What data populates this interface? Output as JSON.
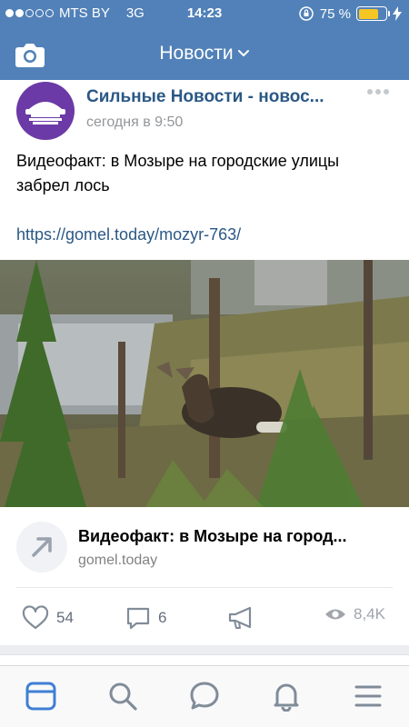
{
  "status_bar": {
    "carrier": "MTS BY",
    "network": "3G",
    "time": "14:23",
    "battery_percent": "75 %",
    "battery_level": 0.75,
    "signal_bars_filled": 2,
    "signal_bars_total": 5
  },
  "header": {
    "title": "Новости",
    "camera_icon": "camera-icon",
    "chevron_icon": "chevron-down-icon"
  },
  "post": {
    "source_name": "Сильные Новости - новос...",
    "time": "сегодня в 9:50",
    "text": "Видеофакт: в Мозыре на городские улицы забрел лось",
    "link": "https://gomel.today/mozyr-763/",
    "snippet": {
      "title": "Видеофакт: в Мозыре на город...",
      "domain": "gomel.today",
      "icon": "external-link-arrow-icon"
    },
    "stats": {
      "likes": "54",
      "comments": "6",
      "views": "8,4K"
    }
  },
  "tab_bar": {
    "items": [
      "news-icon",
      "search-icon",
      "messages-icon",
      "notifications-icon",
      "menu-icon"
    ],
    "active": "news-icon"
  },
  "colors": {
    "header_bg": "#5181b8",
    "link": "#2a5885",
    "avatar_bg": "#6b3aa6",
    "battery_fill": "#f5c624",
    "tab_active": "#3f7fd4",
    "icon_gray": "#818c99"
  }
}
